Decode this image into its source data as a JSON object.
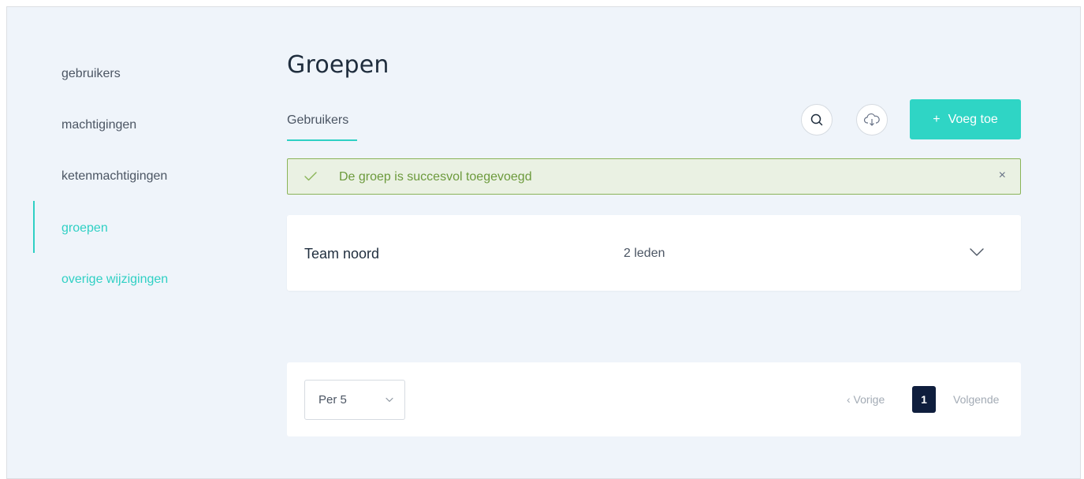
{
  "sidebar": {
    "items": [
      {
        "label": "gebruikers",
        "active": false
      },
      {
        "label": "machtigingen",
        "active": false
      },
      {
        "label": "ketenmachtigingen",
        "active": false
      },
      {
        "label": "groepen",
        "active": true
      },
      {
        "label": "overige wijzigingen",
        "active": false
      }
    ]
  },
  "main": {
    "title": "Groepen",
    "tabs": [
      {
        "label": "Gebruikers",
        "active": true
      }
    ],
    "toolbar": {
      "search_icon": "search-icon",
      "download_icon": "cloud-download-icon",
      "add_label": "Voeg toe",
      "add_icon": "+"
    },
    "alert": {
      "text": "De groep is succesvol toegevoegd",
      "close": "×",
      "type": "success"
    },
    "groups": [
      {
        "name": "Team noord",
        "members": "2 leden"
      }
    ],
    "pagination": {
      "per_page": "Per 5",
      "prev_label": "‹ Vorige",
      "current_page": "1",
      "next_label": "Volgende"
    }
  },
  "colors": {
    "accent": "#2fd0c4",
    "background": "#eff4fa",
    "success_border": "#8ab458",
    "success_bg": "#eaf1e3",
    "success_text": "#6c9a3c",
    "page_active": "#0f1e3d"
  }
}
